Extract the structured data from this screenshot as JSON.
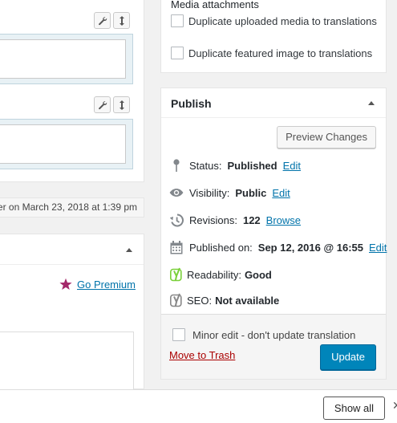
{
  "media": {
    "title": "Media attachments",
    "options": [
      {
        "label": "Duplicate uploaded media to translations",
        "checked": false
      },
      {
        "label": "Duplicate featured image to translations",
        "checked": false
      }
    ]
  },
  "left": {
    "last_modified": "er on March 23, 2018 at 1:39 pm",
    "go_premium": "Go Premium"
  },
  "publish": {
    "title": "Publish",
    "preview_label": "Preview Changes",
    "status_label": "Status:",
    "status_value": "Published",
    "visibility_label": "Visibility:",
    "visibility_value": "Public",
    "revisions_label": "Revisions:",
    "revisions_value": "122",
    "browse_label": "Browse",
    "published_label": "Published on:",
    "published_value": "Sep 12, 2016 @ 16:55",
    "edit_label": "Edit",
    "readability_label": "Readability:",
    "readability_value": "Good",
    "seo_label": "SEO:",
    "seo_value": "Not available",
    "minor_edit_label": "Minor edit - don't update translation",
    "trash_label": "Move to Trash",
    "update_label": "Update"
  },
  "bottom": {
    "show_all": "Show all",
    "close_glyph": "✕"
  },
  "colors": {
    "primary": "#0085ba",
    "link": "#0073aa",
    "danger": "#a00",
    "yoast_good": "#7ad03a",
    "premium_star": "#a4286a"
  }
}
